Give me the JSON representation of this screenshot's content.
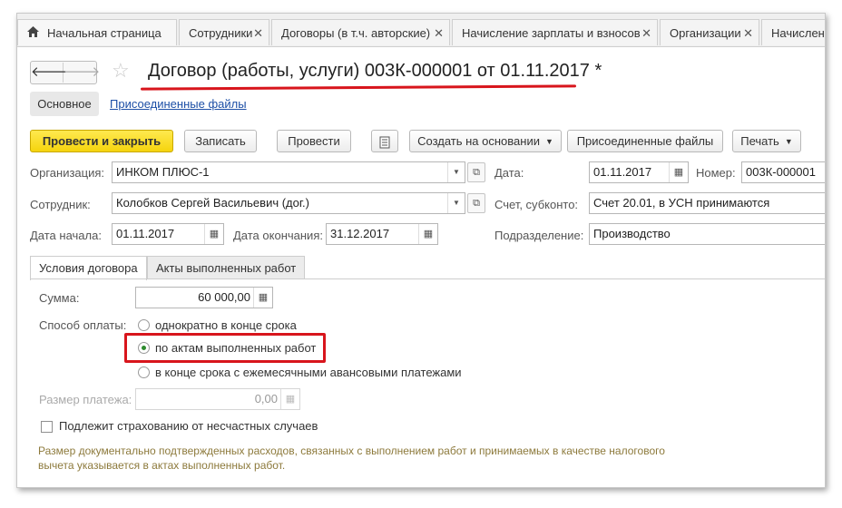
{
  "tabs": [
    {
      "label": "Начальная страница",
      "closable": false
    },
    {
      "label": "Сотрудники",
      "closable": true
    },
    {
      "label": "Договоры (в т.ч. авторские)",
      "closable": true
    },
    {
      "label": "Начисление зарплаты и взносов",
      "closable": true
    },
    {
      "label": "Организации",
      "closable": true
    },
    {
      "label": "Начислен",
      "closable": false
    }
  ],
  "header": {
    "title": "Договор (работы, услуги) 003К-000001 от 01.11.2017 *",
    "subtab_main": "Основное",
    "subtab_link": "Присоединенные файлы"
  },
  "toolbar": {
    "post_close": "Провести и закрыть",
    "save": "Записать",
    "post": "Провести",
    "create_based": "Создать на основании",
    "attached_files": "Присоединенные файлы",
    "print": "Печать"
  },
  "form": {
    "org_label": "Организация:",
    "org_value": "ИНКОМ ПЛЮС-1",
    "date_label": "Дата:",
    "date_value": "01.11.2017",
    "number_label": "Номер:",
    "number_value": "003К-000001",
    "employee_label": "Сотрудник:",
    "employee_value": "Колобков Сергей Васильевич (дог.)",
    "account_label": "Счет, субконто:",
    "account_value": "Счет 20.01, в УСН принимаются",
    "start_label": "Дата начала:",
    "start_value": "01.11.2017",
    "end_label": "Дата окончания:",
    "end_value": "31.12.2017",
    "dept_label": "Подразделение:",
    "dept_value": "Производство"
  },
  "inner_tabs": [
    "Условия договора",
    "Акты выполненных работ"
  ],
  "terms": {
    "sum_label": "Сумма:",
    "sum_value": "60 000,00",
    "payment_label": "Способ оплаты:",
    "payment_options": [
      "однократно в конце срока",
      "по актам выполненных работ",
      "в конце срока с ежемесячными авансовыми платежами"
    ],
    "payment_selected": 1,
    "payment_size_label": "Размер платежа:",
    "payment_size_value": "0,00",
    "insurance_label": "Подлежит страхованию от несчастных случаев",
    "insurance_checked": false,
    "note": "Размер документально подтвержденных расходов, связанных с выполнением работ и принимаемых в качестве налогового вычета указывается в актах выполненных работ."
  },
  "colors": {
    "accent_yellow": "#f5d40d",
    "highlight_red": "#d8151c",
    "link_blue": "#1d4fa6",
    "note_text": "#8d7a3c"
  },
  "icons": {
    "home": "home-icon",
    "star": "star-icon",
    "back": "arrow-left-icon",
    "forward": "arrow-right-icon",
    "calendar": "calendar-icon",
    "dropdown": "chevron-down-icon",
    "open": "open-form-icon",
    "calculator": "calculator-icon"
  }
}
